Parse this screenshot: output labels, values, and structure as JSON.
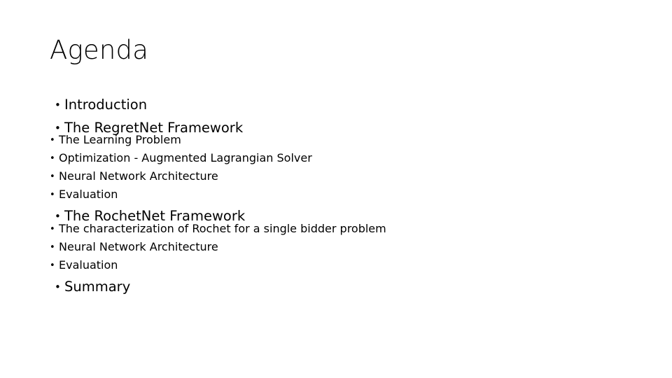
{
  "slide": {
    "title": "Agenda",
    "background_color": "#ffffff",
    "text_color": "#000000",
    "bullet_glyph": "•",
    "outline": [
      {
        "label": "Introduction",
        "level": 1,
        "children": []
      },
      {
        "label": "The RegretNet Framework",
        "level": 1,
        "children": [
          {
            "label": "The Learning Problem",
            "level": 2
          },
          {
            "label": "Optimization - Augmented Lagrangian Solver",
            "level": 2
          },
          {
            "label": "Neural Network Architecture",
            "level": 2
          },
          {
            "label": "Evaluation",
            "level": 2
          }
        ]
      },
      {
        "label": "The RochetNet Framework",
        "level": 1,
        "children": [
          {
            "label": "The characterization of Rochet for a single bidder problem",
            "level": 2
          },
          {
            "label": "Neural Network Architecture",
            "level": 2
          },
          {
            "label": "Evaluation",
            "level": 2
          }
        ]
      },
      {
        "label": "Summary",
        "level": 1,
        "children": []
      }
    ]
  }
}
